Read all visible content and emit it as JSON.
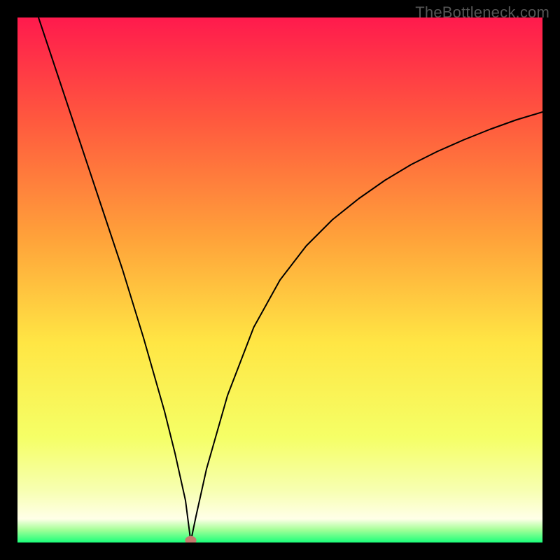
{
  "watermark": "TheBottleneck.com",
  "chart_data": {
    "type": "line",
    "title": "",
    "xlabel": "",
    "ylabel": "",
    "xlim": [
      0,
      100
    ],
    "ylim": [
      0,
      100
    ],
    "grid": false,
    "marker": {
      "x": 33,
      "y": 0,
      "color": "#c47a6d",
      "radius": 1.2
    },
    "series": [
      {
        "name": "curve",
        "color": "#000000",
        "stroke_width": 2,
        "x": [
          4,
          8,
          12,
          16,
          20,
          24,
          28,
          30,
          32,
          33,
          34,
          36,
          40,
          45,
          50,
          55,
          60,
          65,
          70,
          75,
          80,
          85,
          90,
          95,
          100
        ],
        "values": [
          100,
          88,
          76,
          64,
          52,
          39,
          25,
          17,
          8,
          0.2,
          5,
          14,
          28,
          41,
          50,
          56.5,
          61.5,
          65.5,
          69,
          72,
          74.5,
          76.7,
          78.7,
          80.5,
          82
        ]
      }
    ],
    "background_gradient": {
      "type": "vertical",
      "stops": [
        {
          "offset": 0.0,
          "color": "#ff1a4d"
        },
        {
          "offset": 0.2,
          "color": "#ff5a3e"
        },
        {
          "offset": 0.42,
          "color": "#ffa23a"
        },
        {
          "offset": 0.62,
          "color": "#ffe644"
        },
        {
          "offset": 0.8,
          "color": "#f5ff66"
        },
        {
          "offset": 0.9,
          "color": "#f7ffb0"
        },
        {
          "offset": 0.955,
          "color": "#ffffe8"
        },
        {
          "offset": 0.975,
          "color": "#a8ff9a"
        },
        {
          "offset": 1.0,
          "color": "#1bff7a"
        }
      ]
    }
  }
}
